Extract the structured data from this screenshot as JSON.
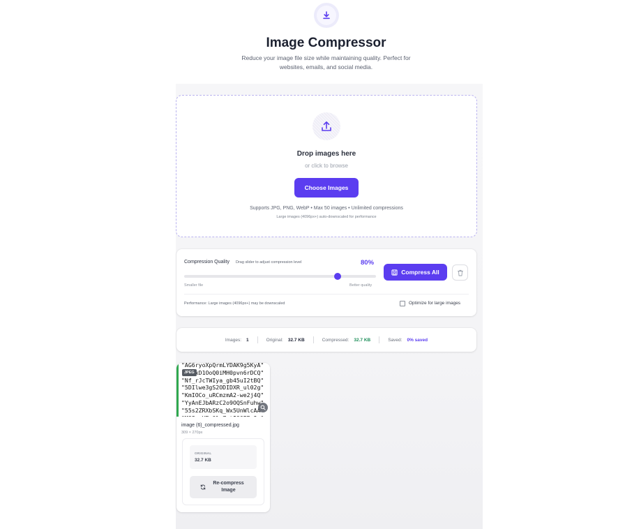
{
  "header": {
    "icon": "download-icon",
    "title": "Image Compressor",
    "subtitle": "Reduce your image file size while maintaining quality. Perfect for websites, emails, and social media."
  },
  "dropzone": {
    "icon": "upload-icon",
    "title": "Drop images here",
    "subtitle": "or click to browse",
    "button_label": "Choose Images",
    "supports": "Supports JPG, PNG, WebP • Max 50 images • Unlimited compressions",
    "large_note": "Large images (4096px+) auto-downscaled for performance"
  },
  "quality": {
    "label": "Compression Quality",
    "hint": "Drag slider to adjust compression level",
    "value_text": "80%",
    "value": 80,
    "min_label": "Smaller file",
    "max_label": "Better quality",
    "compress_button": "Compress All",
    "perf_note": "Performance: Large images (4096px+) may be downscaled",
    "optimize_label": "Optimize for large images",
    "optimize_checked": false
  },
  "stats": {
    "images_label": "Images:",
    "images_value": "1",
    "original_label": "Original:",
    "original_value": "32.7 KB",
    "compressed_label": "Compressed:",
    "compressed_value": "32.7 KB",
    "saved_label": "Saved:",
    "saved_value": "0% saved"
  },
  "image_card": {
    "badge": "JPEG",
    "filename": "image (6)_compressed.jpg",
    "dimensions": "309 × 270px",
    "original_label": "ORIGINAL",
    "original_value": "32.7 KB",
    "recompress_label": "Re-compress Image"
  },
  "colors": {
    "accent": "#5b3df0",
    "success": "#1e8f5a",
    "thumb_border": "#2fa84f"
  }
}
